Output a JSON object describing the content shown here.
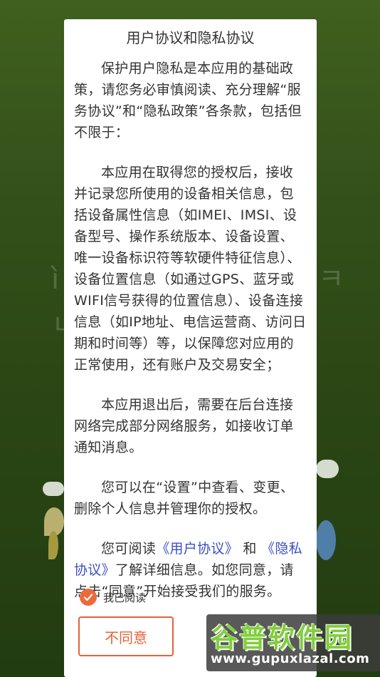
{
  "dialog": {
    "title": "用户协议和隐私协议",
    "paragraphs": {
      "p1": "保护用户隐私是本应用的基础政策，请您务必审慎阅读、充分理解“服务协议”和“隐私政策”各条款，包括但不限于：",
      "p2": "本应用在取得您的授权后，接收并记录您所使用的设备相关信息，包括设备属性信息（如IMEI、IMSI、设备型号、操作系统版本、设备设置、唯一设备标识符等软硬件特征信息）、设备位置信息（如通过GPS、蓝牙或WIFI信号获得的位置信息）、设备连接信息（如IP地址、电信运营商、访问日期和时间等）等，以保障您对应用的正常使用，还有账户及交易安全；",
      "p3": "本应用退出后，需要在后台连接网络完成部分网络服务，如接收订单通知消息。",
      "p4": "您可以在“设置”中查看、变更、删除个人信息并管理你的授权。",
      "p5_pre": "您可阅读",
      "p5_link_user": "《用户协议》",
      "p5_and": "和",
      "p5_link_privacy": "《隐私协议》",
      "p5_post": "了解详细信息。如您同意，请点击“同意”开始接受我们的服务。"
    },
    "agree_checkbox": {
      "label": "我已阅读",
      "checked": true
    },
    "disagree_button": "不同意"
  },
  "watermark": {
    "title": "谷普软件园",
    "url": "www.gupuxlazal.com"
  },
  "colors": {
    "accent": "#e6623a",
    "link": "#3b4fc4",
    "background": "#2c4714"
  }
}
